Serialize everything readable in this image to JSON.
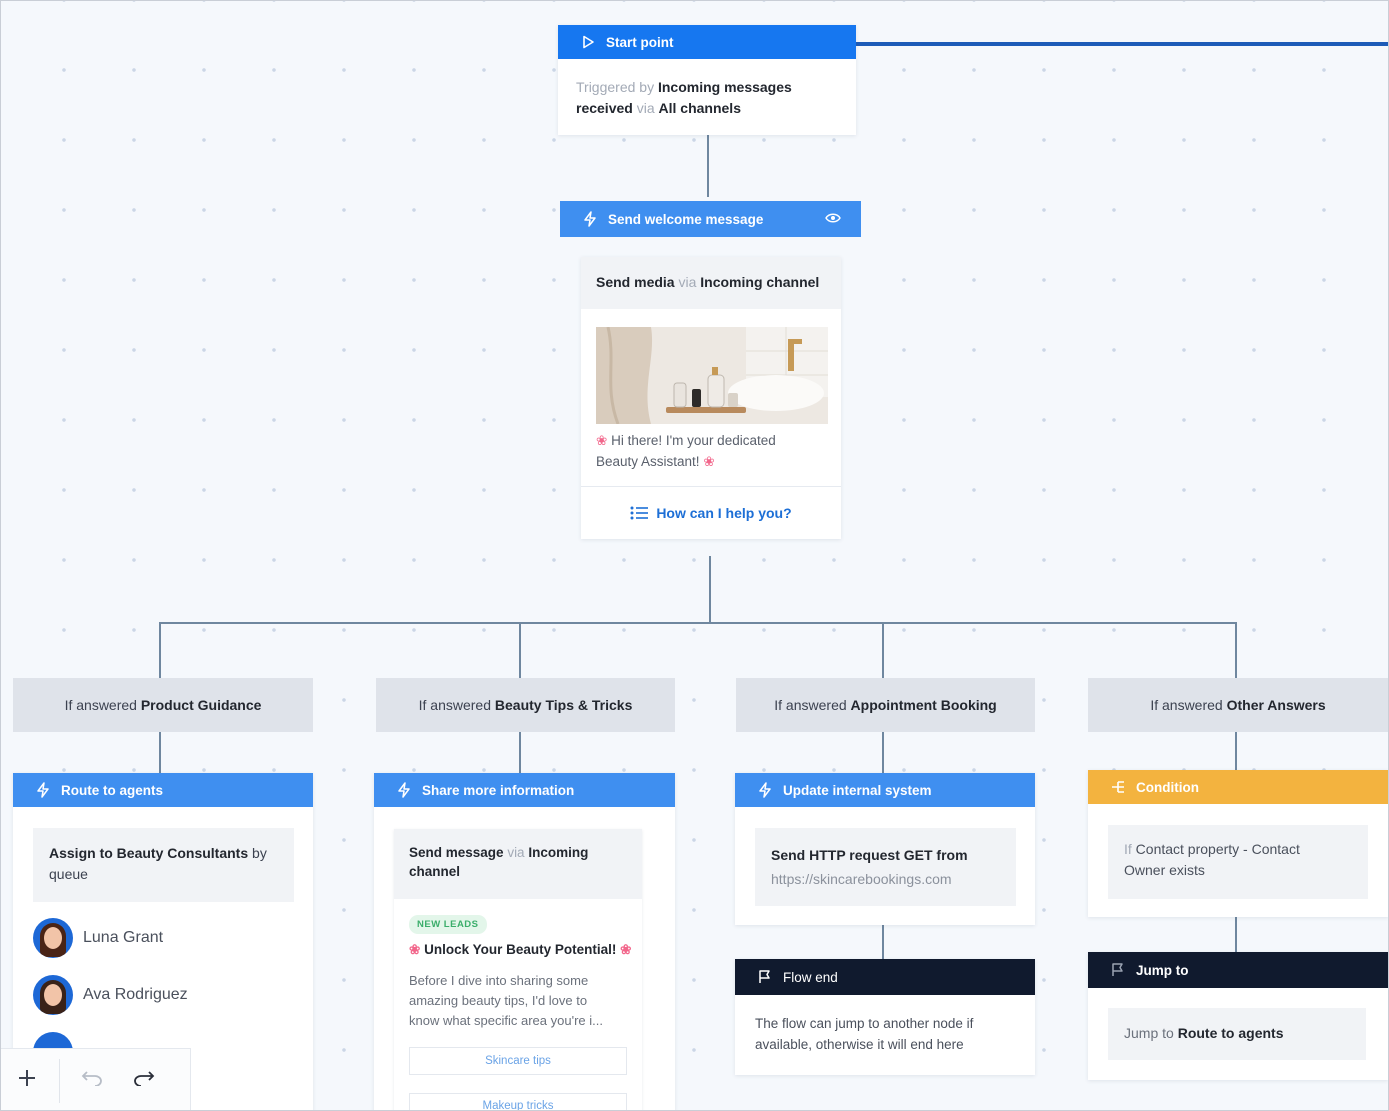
{
  "start": {
    "title": "Start point",
    "triggered_by": "Triggered by",
    "incoming": "Incoming messages",
    "received": "received",
    "via": "via",
    "channels": "All channels"
  },
  "welcome": {
    "title": "Send welcome message",
    "send_media": "Send media",
    "via": "via",
    "incoming_channel": "Incoming channel",
    "greeting_1": "Hi there! I'm your dedicated",
    "greeting_2": "Beauty Assistant!",
    "question": "How can I help you?"
  },
  "branches": [
    {
      "prefix": "If answered",
      "label": "Product Guidance"
    },
    {
      "prefix": "If answered",
      "label": "Beauty Tips & Tricks"
    },
    {
      "prefix": "If answered",
      "label": "Appointment Booking"
    },
    {
      "prefix": "If answered",
      "label": "Other Answers"
    }
  ],
  "route": {
    "title": "Route to agents",
    "assign": "Assign to Beauty Consultants",
    "by": "by",
    "queue": "queue",
    "agents": [
      "Luna Grant",
      "Ava Rodriguez"
    ]
  },
  "share": {
    "title": "Share more information",
    "send_message": "Send message",
    "via": "via",
    "incoming": "Incoming",
    "channel": "channel",
    "tag": "NEW LEADS",
    "headline": "Unlock Your Beauty Potential!",
    "body_1": "Before I dive into sharing some",
    "body_2": "amazing beauty tips, I'd love to",
    "body_3": "know what specific area you're i...",
    "options": [
      "Skincare tips",
      "Makeup tricks"
    ]
  },
  "update": {
    "title": "Update internal system",
    "http": "Send HTTP request GET from",
    "url": "https://skincarebookings.com"
  },
  "flow_end": {
    "title": "Flow end",
    "text_1": "The flow can jump to another node if",
    "text_2": "available, otherwise it will end here"
  },
  "condition": {
    "title": "Condition",
    "if": "If",
    "cond_1": "Contact property - Contact",
    "cond_2": "Owner exists"
  },
  "jump": {
    "title": "Jump to",
    "jump_to": "Jump to",
    "target": "Route to agents"
  },
  "colors": {
    "primary_blue": "#1677f0",
    "action_blue": "#3f8ff0",
    "condition_amber": "#f3b33f",
    "end_navy": "#101a2e",
    "connector": "#6f879f"
  },
  "icons": {
    "start": "play-icon",
    "action": "lightning-icon",
    "preview": "eye-icon",
    "list": "list-icon",
    "condition": "branch-icon",
    "end": "flag-icon",
    "add": "plus-icon",
    "undo": "undo-icon",
    "redo": "redo-icon"
  }
}
